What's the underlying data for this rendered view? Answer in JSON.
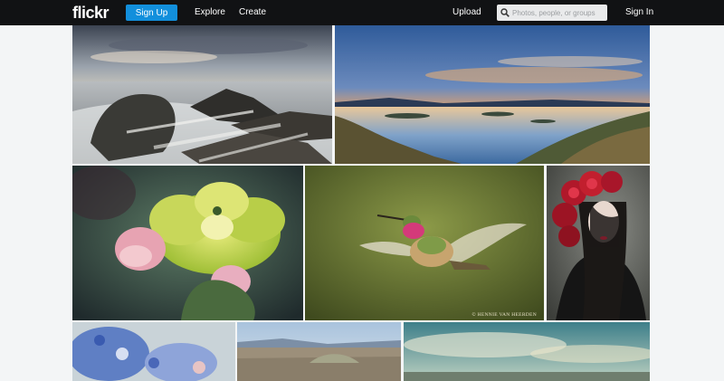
{
  "header": {
    "logo": "flickr",
    "signup_label": "Sign Up",
    "nav": {
      "explore": "Explore",
      "create": "Create",
      "upload": "Upload",
      "signin": "Sign In"
    },
    "search": {
      "placeholder": "Photos, people, or groups",
      "icon": "search-icon"
    }
  },
  "photos": [
    {
      "subject": "rocky-coastline-photo"
    },
    {
      "subject": "lake-sunset-photo"
    },
    {
      "subject": "cactus-flower-photo"
    },
    {
      "subject": "hummingbird-photo",
      "credit": "© HENNIE VAN HEERDEN"
    },
    {
      "subject": "red-rose-portrait-photo"
    },
    {
      "subject": "blue-flowers-photo"
    },
    {
      "subject": "city-panorama-photo"
    },
    {
      "subject": "cloudy-beach-photo"
    }
  ],
  "colors": {
    "topbar": "#111214",
    "accent": "#128fdc",
    "page_bg": "#f3f5f6"
  }
}
